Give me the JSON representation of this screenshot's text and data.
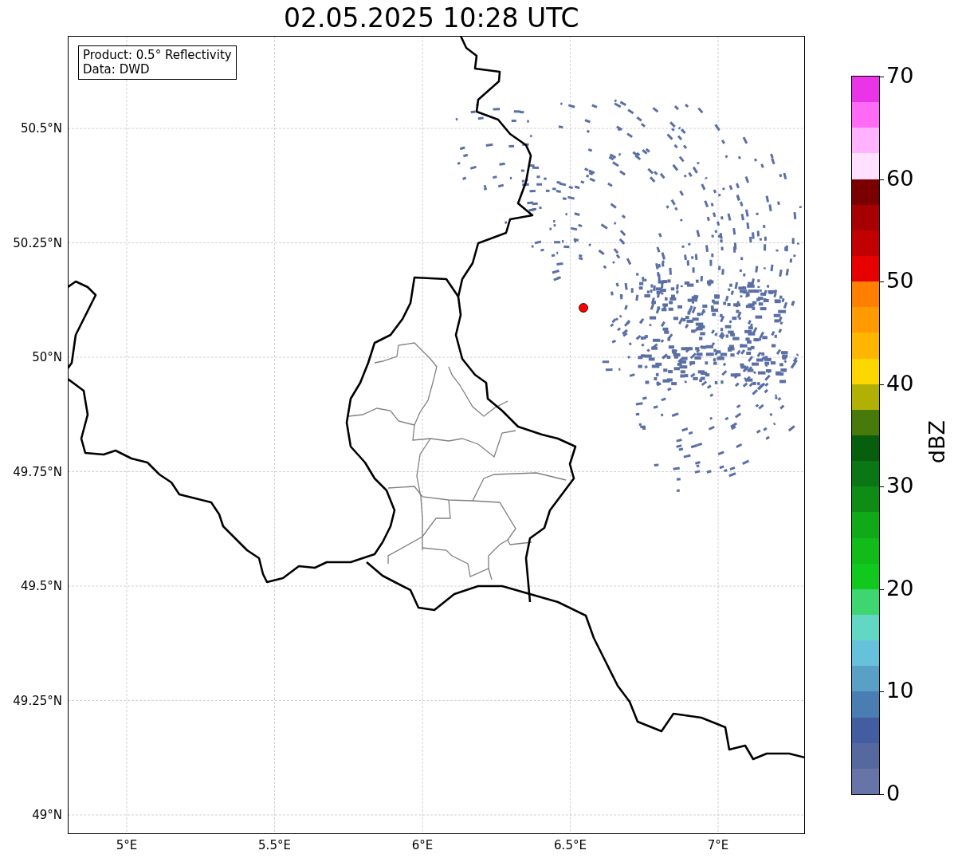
{
  "title": "02.05.2025 10:28 UTC",
  "legend": [
    "Product: 0.5° Reflectivity",
    "Data: DWD"
  ],
  "y_ticks": [
    "50.5°N",
    "50.25°N",
    "50°N",
    "49.75°N",
    "49.5°N",
    "49.25°N",
    "49°N"
  ],
  "x_ticks": [
    "5°E",
    "5.5°E",
    "6°E",
    "6.5°E",
    "7°E"
  ],
  "colorbar": {
    "label": "dBZ",
    "ticks": [
      "70",
      "60",
      "50",
      "40",
      "30",
      "20",
      "10",
      "0"
    ],
    "bands": [
      {
        "color": "#6674a8"
      },
      {
        "color": "#55699f"
      },
      {
        "color": "#435ea0"
      },
      {
        "color": "#4a7db2"
      },
      {
        "color": "#5aa0c6"
      },
      {
        "color": "#66c2db"
      },
      {
        "color": "#62d8c4"
      },
      {
        "color": "#3dd670"
      },
      {
        "color": "#11c91e"
      },
      {
        "color": "#10bb1a"
      },
      {
        "color": "#10aa18"
      },
      {
        "color": "#0e8c16"
      },
      {
        "color": "#0b7714"
      },
      {
        "color": "#075e0c"
      },
      {
        "color": "#477a0a"
      },
      {
        "color": "#b0b005"
      },
      {
        "color": "#ffd700"
      },
      {
        "color": "#ffb600"
      },
      {
        "color": "#ff9a00"
      },
      {
        "color": "#ff7f00"
      },
      {
        "color": "#e60000"
      },
      {
        "color": "#c30000"
      },
      {
        "color": "#a60000"
      },
      {
        "color": "#7a0000"
      },
      {
        "color": "#ffe0ff"
      },
      {
        "color": "#ffb3ff"
      },
      {
        "color": "#ff6bf5"
      },
      {
        "color": "#e934e8"
      }
    ]
  }
}
